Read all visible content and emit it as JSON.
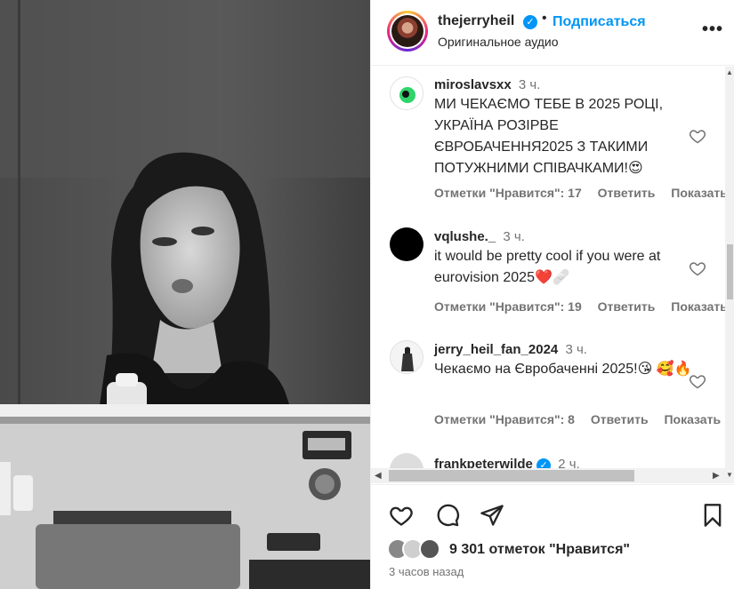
{
  "post": {
    "username": "thejerryheil",
    "verified_mark": "✓",
    "separator": "•",
    "follow_label": "Подписаться",
    "audio_label": "Оригинальное аудио",
    "more_label": "•••"
  },
  "comments": [
    {
      "username": "miroslavsxx",
      "time": "3 ч.",
      "text": "МИ ЧЕКАЄМО ТЕБЕ В 2025 РОЦІ, УКРАЇНА РОЗІРВЕ ЄВРОБАЧЕННЯ2025 З ТАКИМИ ПОТУЖНИМИ СПІВАЧКАМИ!😍",
      "likes_label": "Отметки \"Нравится\": 17",
      "reply_label": "Ответить",
      "show_label": "Показать"
    },
    {
      "username": "vqlushe._",
      "time": "3 ч.",
      "text": "it would be pretty cool if you were at eurovision 2025❤️🩹",
      "likes_label": "Отметки \"Нравится\": 19",
      "reply_label": "Ответить",
      "show_label": "Показать"
    },
    {
      "username": "jerry_heil_fan_2024",
      "time": "3 ч.",
      "text": "Чекаємо на Євробаченні 2025!😘 🥰🔥",
      "likes_label": "Отметки \"Нравится\": 8",
      "reply_label": "Ответить",
      "show_label": "Показать"
    },
    {
      "username": "frankpeterwilde",
      "time": "2 ч."
    }
  ],
  "footer": {
    "likes_text": "9 301 отметок \"Нравится\"",
    "time_ago": "3 часов назад"
  },
  "icons": {
    "heart": "heart-icon",
    "comment": "comment-icon",
    "share": "paper-plane-icon",
    "save": "bookmark-icon"
  },
  "colors": {
    "accent": "#0095f6",
    "text": "#262626",
    "secondary": "#737373"
  }
}
